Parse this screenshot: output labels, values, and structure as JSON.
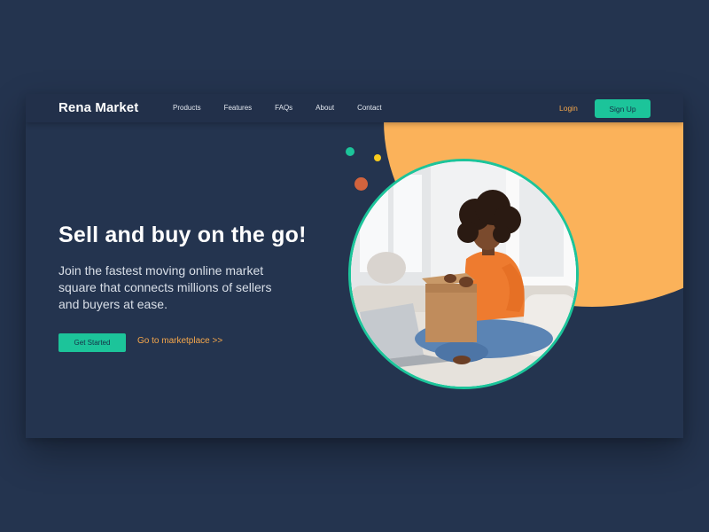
{
  "brand": "Rena Market",
  "nav": [
    "Products",
    "Features",
    "FAQs",
    "About",
    "Contact"
  ],
  "auth": {
    "login": "Login",
    "signup": "Sign Up"
  },
  "hero": {
    "title": "Sell and buy on the go!",
    "description": "Join the fastest moving online market square that connects millions of sellers and buyers at ease.",
    "primary_button": "Get Started",
    "secondary_link": "Go to marketplace >>"
  },
  "colors": {
    "background": "#24344f",
    "accent_green": "#1cc49a",
    "accent_orange": "#fbb25a",
    "link_orange": "#f6a74b",
    "dot_yellow": "#f9cb1d",
    "dot_red": "#d2633d"
  }
}
